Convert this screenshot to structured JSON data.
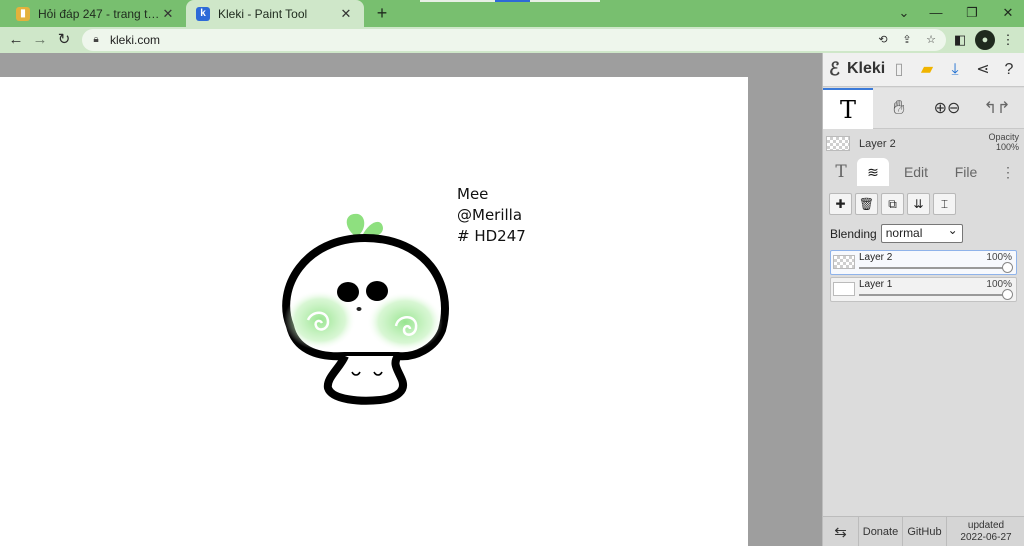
{
  "browser": {
    "tabs": [
      {
        "title": "Hỏi đáp 247 - trang tra loi",
        "favicon": "hoidap-favicon",
        "active": false
      },
      {
        "title": "Kleki - Paint Tool",
        "favicon": "kleki-favicon",
        "active": true
      }
    ],
    "url": "kleki.com"
  },
  "canvas": {
    "text_lines": [
      "Mee",
      "@Merilla",
      "# HD247"
    ]
  },
  "kleki": {
    "logo_text": "Kleki",
    "current_layer": {
      "name": "Layer 2",
      "opacity_label": "Opacity",
      "opacity_value": "100%"
    },
    "tabs": {
      "edit": "Edit",
      "file": "File"
    },
    "blending_label": "Blending",
    "blending_value": "normal",
    "layers": [
      {
        "name": "Layer 2",
        "opacity": "100%",
        "opacity_fraction": 1.0,
        "selected": true
      },
      {
        "name": "Layer 1",
        "opacity": "100%",
        "opacity_fraction": 1.0,
        "selected": false
      }
    ],
    "footer": {
      "donate": "Donate",
      "github": "GitHub",
      "updated_label": "updated",
      "updated_date": "2022-06-27"
    }
  },
  "colors": {
    "chrome_green": "#78bf6f",
    "toolbar_green": "#cfe7c9",
    "accent_blue": "#3b7ad8",
    "art_green": "#86e07c"
  }
}
